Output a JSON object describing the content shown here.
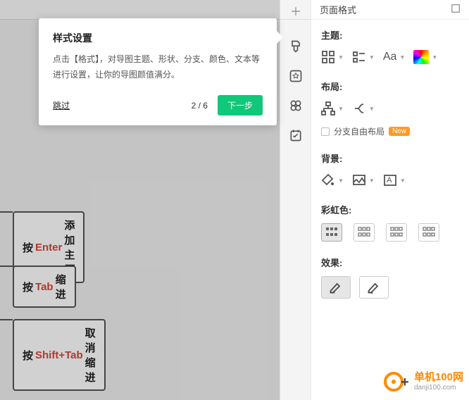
{
  "tooltip": {
    "title": "样式设置",
    "body": "点击【格式】，对导图主题、形状、分支、颜色、文本等进行设置，让你的导图颜值满分。",
    "skip": "跳过",
    "progress": "2 / 6",
    "next": "下一步"
  },
  "panel": {
    "title": "页面格式",
    "close_icon": "close"
  },
  "sections": {
    "theme": {
      "label": "主题:",
      "text_btn": "Aa"
    },
    "layout": {
      "label": "布局:",
      "free_label": "分支自由布局",
      "badge": "New"
    },
    "background": {
      "label": "背景:",
      "bg3_letter": "A"
    },
    "rainbow": {
      "label": "彩虹色:"
    },
    "effect": {
      "label": "效果:"
    }
  },
  "nodes": [
    {
      "pre": "按 ",
      "kw": "Enter",
      "post": " 添加主题"
    },
    {
      "pre": "按 ",
      "kw": "Tab",
      "post": " 缩进"
    },
    {
      "pre": "按 ",
      "kw": "Shift+Tab",
      "post": " 取消缩进"
    }
  ],
  "logo": {
    "t1": "单机100网",
    "t2": "danji100.com"
  }
}
